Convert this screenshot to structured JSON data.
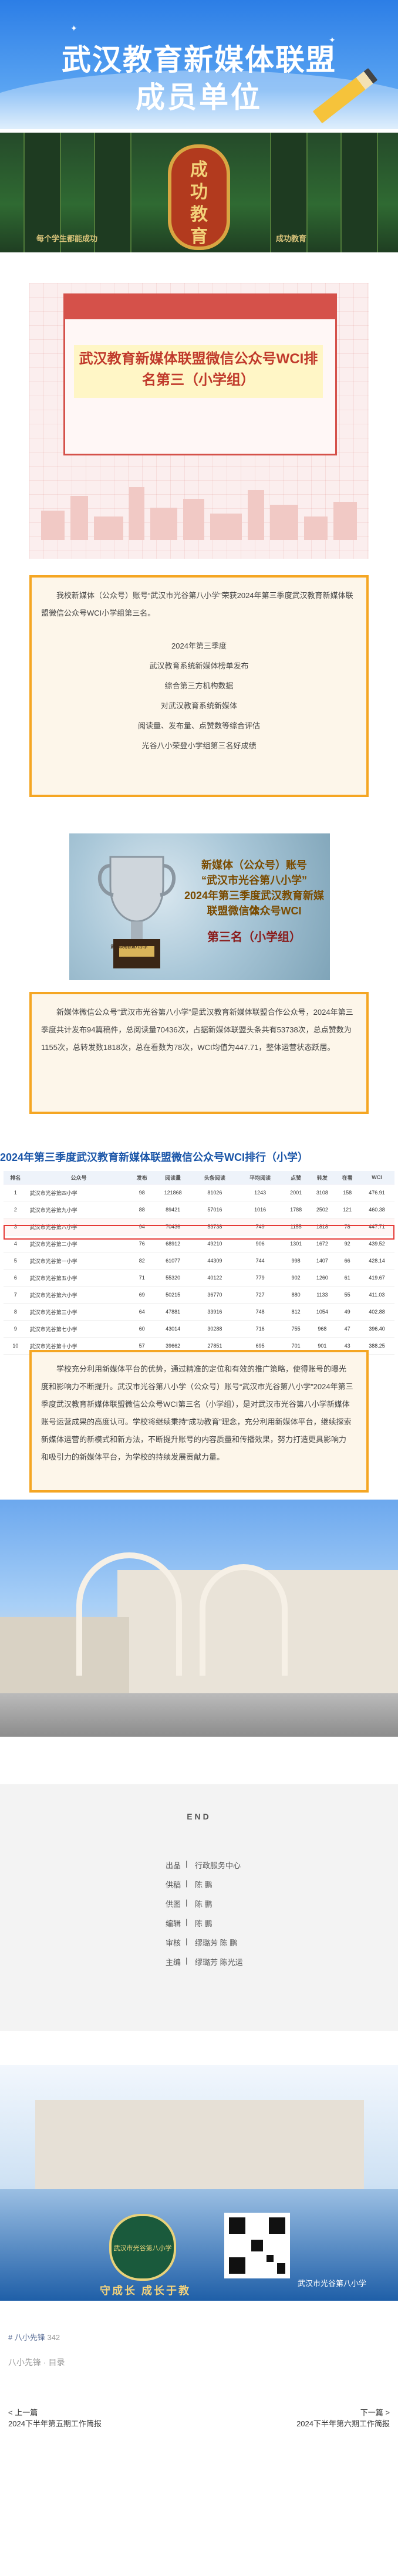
{
  "banner": {
    "title_line1": "武汉教育新媒体联盟",
    "title_line2": "成员单位"
  },
  "board": {
    "motto": [
      "成",
      "功",
      "教",
      "育"
    ],
    "left_caption": "每个学生都能成功",
    "right_caption": "成功教育"
  },
  "card": {
    "title": "武汉教育新媒体联盟微信公众号WCI排名第三（小学组）"
  },
  "intro": {
    "paragraph": "我校新媒体（公众号）账号“武汉市光谷第八小学”荣获2024年第三季度武汉教育新媒体联盟微信公众号WCI小学组第三名。",
    "lines": [
      "2024年第三季度",
      "武汉教育系统新媒体榜单发布",
      "综合第三方机构数据",
      "对武汉教育系统新媒体",
      "阅读量、发布量、点赞数等综合评估",
      "光谷八小荣登小学组第三名好成绩"
    ]
  },
  "award": {
    "line1": "新媒体（公众号）账号",
    "line2": "“武汉市光谷第八小学”",
    "line3": "2024年第三季度武汉教育新媒体",
    "line4": "联盟微信公众号WCI",
    "line5": "第三名（小学组）",
    "plaque": "武汉市光谷第八小学"
  },
  "stats": {
    "paragraph": "新媒体微信公众号“武汉市光谷第八小学”是武汉教育新媒体联盟合作公众号，2024年第三季度共计发布94篇稿件，总阅读量70436次，占据新媒体联盟头条共有53738次，总点赞数为1155次，总转发数1818次，总在看数为78次，WCI均值为447.71，整体运营状态跃居。"
  },
  "table": {
    "title": "2024年第三季度武汉教育新媒体联盟微信公众号WCI排行（小学）",
    "headers": [
      "排名",
      "公众号",
      "发布",
      "阅读量",
      "头条阅读",
      "平均阅读",
      "点赞",
      "转发",
      "在看",
      "WCI"
    ],
    "rows": [
      [
        "1",
        "武汉市光谷第四小学",
        "98",
        "121868",
        "81026",
        "1243",
        "2001",
        "3108",
        "158",
        "476.91"
      ],
      [
        "2",
        "武汉市光谷第九小学",
        "88",
        "89421",
        "57016",
        "1016",
        "1788",
        "2502",
        "121",
        "460.38"
      ],
      [
        "3",
        "武汉市光谷第八小学",
        "94",
        "70436",
        "53738",
        "749",
        "1155",
        "1818",
        "78",
        "447.71"
      ],
      [
        "4",
        "武汉市光谷第二小学",
        "76",
        "68912",
        "49210",
        "906",
        "1301",
        "1672",
        "92",
        "439.52"
      ],
      [
        "5",
        "武汉市光谷第一小学",
        "82",
        "61077",
        "44309",
        "744",
        "998",
        "1407",
        "66",
        "428.14"
      ],
      [
        "6",
        "武汉市光谷第五小学",
        "71",
        "55320",
        "40122",
        "779",
        "902",
        "1260",
        "61",
        "419.67"
      ],
      [
        "7",
        "武汉市光谷第六小学",
        "69",
        "50215",
        "36770",
        "727",
        "880",
        "1133",
        "55",
        "411.03"
      ],
      [
        "8",
        "武汉市光谷第三小学",
        "64",
        "47881",
        "33916",
        "748",
        "812",
        "1054",
        "49",
        "402.88"
      ],
      [
        "9",
        "武汉市光谷第七小学",
        "60",
        "43014",
        "30288",
        "716",
        "755",
        "968",
        "47",
        "396.40"
      ],
      [
        "10",
        "武汉市光谷第十小学",
        "57",
        "39662",
        "27851",
        "695",
        "701",
        "901",
        "43",
        "388.25"
      ]
    ]
  },
  "closing": {
    "paragraph": "学校充分利用新媒体平台的优势，通过精准的定位和有效的推广策略，使得账号的曝光度和影响力不断提升。武汉市光谷第八小学（公众号）账号“武汉市光谷第八小学”2024年第三季度武汉教育新媒体联盟微信公众号WCI第三名（小学组），是对武汉市光谷第八小学新媒体账号运营成果的高度认可。学校将继续秉持“成功教育”理念，充分利用新媒体平台，继续探索新媒体运营的新模式和新方法，不断提升账号的内容质量和传播效果，努力打造更具影响力和吸引力的新媒体平台，为学校的持续发展贡献力量。"
  },
  "end": {
    "label": "END",
    "credits": [
      {
        "k": "出品",
        "v": "行政服务中心"
      },
      {
        "k": "供稿",
        "v": "陈 鹏"
      },
      {
        "k": "供图",
        "v": "陈 鹏"
      },
      {
        "k": "编辑",
        "v": "陈 鹏"
      },
      {
        "k": "审核",
        "v": "缪璐芳 陈 鹏"
      },
      {
        "k": "主编",
        "v": "缪璐芳 陈光运"
      }
    ]
  },
  "promo": {
    "slogan": "守成长 成长于教",
    "qr_caption": "武汉市光谷第八小学",
    "logo_text": "武汉市光谷第八小学"
  },
  "footer": {
    "tag": "# 八小先锋",
    "tag_count": "342",
    "series": "八小先锋 · 目录",
    "prev_label": "< 上一篇",
    "prev_title": "2024下半年第五期工作简报",
    "next_label": "下一篇 >",
    "next_title": "2024下半年第六期工作简报"
  }
}
